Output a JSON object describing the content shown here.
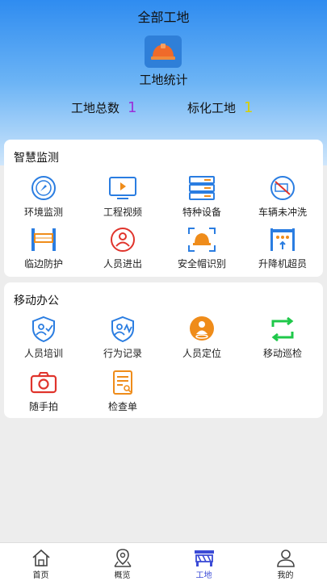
{
  "header": {
    "site_title": "全部工地",
    "stats_title": "工地统计",
    "total_label": "工地总数",
    "total_value": "1",
    "std_label": "标化工地",
    "std_value": "1"
  },
  "colors": {
    "header_top": "#2f8cf0",
    "total_value": "#9b30d8",
    "std_value": "#d8d000",
    "icon_blue": "#2a7de1",
    "icon_red": "#e0342c",
    "icon_orange": "#ef8c1a",
    "icon_green": "#1fc84a",
    "tab_active": "#3b4bd6"
  },
  "smart_monitor": {
    "title": "智慧监测",
    "items": [
      {
        "label": "环境监测",
        "icon": "compass-icon"
      },
      {
        "label": "工程视频",
        "icon": "video-screen-icon"
      },
      {
        "label": "特种设备",
        "icon": "server-rack-icon"
      },
      {
        "label": "车辆未冲洗",
        "icon": "truck-wash-icon"
      },
      {
        "label": "临边防护",
        "icon": "guardrail-icon"
      },
      {
        "label": "人员进出",
        "icon": "person-badge-icon"
      },
      {
        "label": "安全帽识别",
        "icon": "helmet-scan-icon"
      },
      {
        "label": "升降机超员",
        "icon": "elevator-icon"
      }
    ]
  },
  "mobile_office": {
    "title": "移动办公",
    "items": [
      {
        "label": "人员培训",
        "icon": "shield-person-icon"
      },
      {
        "label": "行为记录",
        "icon": "shield-activity-icon"
      },
      {
        "label": "人员定位",
        "icon": "location-person-icon"
      },
      {
        "label": "移动巡检",
        "icon": "cycle-arrows-icon"
      },
      {
        "label": "随手拍",
        "icon": "camera-icon"
      },
      {
        "label": "检查单",
        "icon": "checklist-icon"
      }
    ]
  },
  "tabbar": {
    "items": [
      {
        "label": "首页",
        "icon": "home-icon"
      },
      {
        "label": "概览",
        "icon": "map-pin-icon"
      },
      {
        "label": "工地",
        "icon": "construction-icon"
      },
      {
        "label": "我的",
        "icon": "user-icon"
      }
    ],
    "active": "工地"
  }
}
